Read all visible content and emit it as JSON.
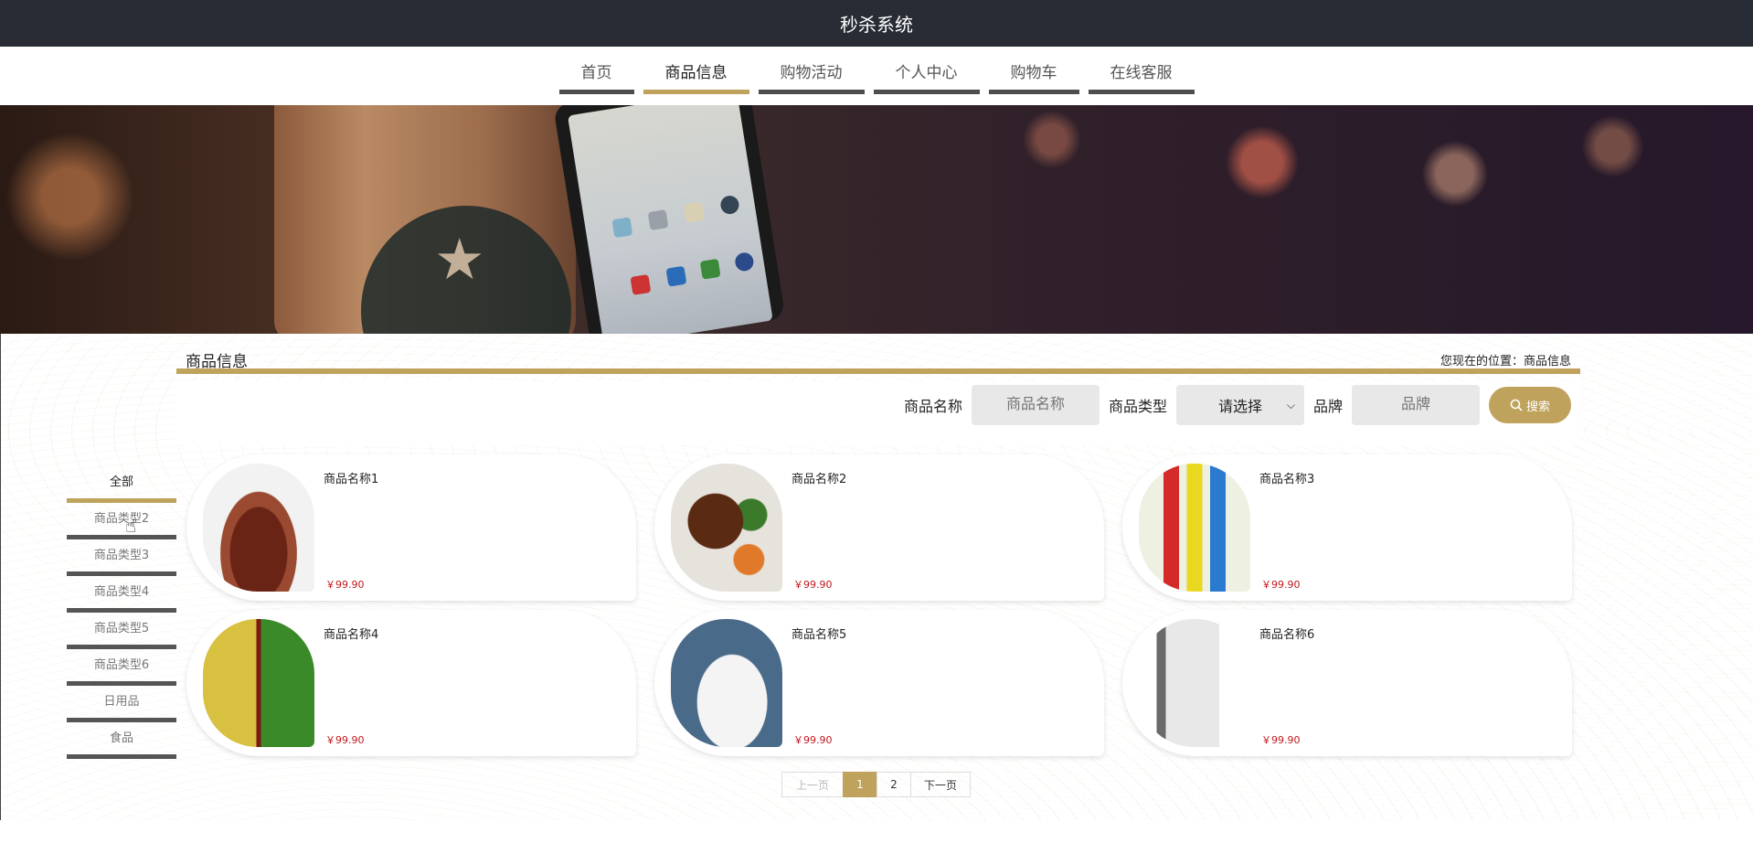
{
  "header": {
    "title": "秒杀系统"
  },
  "nav": {
    "items": [
      {
        "label": "首页",
        "active": false
      },
      {
        "label": "商品信息",
        "active": true
      },
      {
        "label": "购物活动",
        "active": false
      },
      {
        "label": "个人中心",
        "active": false
      },
      {
        "label": "购物车",
        "active": false
      },
      {
        "label": "在线客服",
        "active": false
      }
    ]
  },
  "page": {
    "title": "商品信息",
    "location_label": "您现在的位置：",
    "location_value": "商品信息"
  },
  "search": {
    "name_label": "商品名称",
    "name_placeholder": "商品名称",
    "type_label": "商品类型",
    "type_selected": "请选择",
    "brand_label": "品牌",
    "brand_placeholder": "品牌",
    "button_label": "搜索"
  },
  "categories": [
    {
      "label": "全部",
      "active": true
    },
    {
      "label": "商品类型2",
      "active": false
    },
    {
      "label": "商品类型3",
      "active": false
    },
    {
      "label": "商品类型4",
      "active": false
    },
    {
      "label": "商品类型5",
      "active": false
    },
    {
      "label": "商品类型6",
      "active": false
    },
    {
      "label": "日用品",
      "active": false
    },
    {
      "label": "食品",
      "active": false
    }
  ],
  "products": [
    {
      "name": "商品名称1",
      "price": "￥99.90",
      "image": "shoes"
    },
    {
      "name": "商品名称2",
      "price": "￥99.90",
      "image": "food-plate"
    },
    {
      "name": "商品名称3",
      "price": "￥99.90",
      "image": "bottles"
    },
    {
      "name": "商品名称4",
      "price": "￥99.90",
      "image": "bento"
    },
    {
      "name": "商品名称5",
      "price": "￥99.90",
      "image": "sneaker"
    },
    {
      "name": "商品名称6",
      "price": "￥99.90",
      "image": "book"
    }
  ],
  "pagination": {
    "prev_label": "上一页",
    "pages": [
      "1",
      "2"
    ],
    "current": "1",
    "next_label": "下一页"
  },
  "colors": {
    "accent": "#bfa25b",
    "topbar": "#272c35",
    "price": "#c0181e"
  }
}
